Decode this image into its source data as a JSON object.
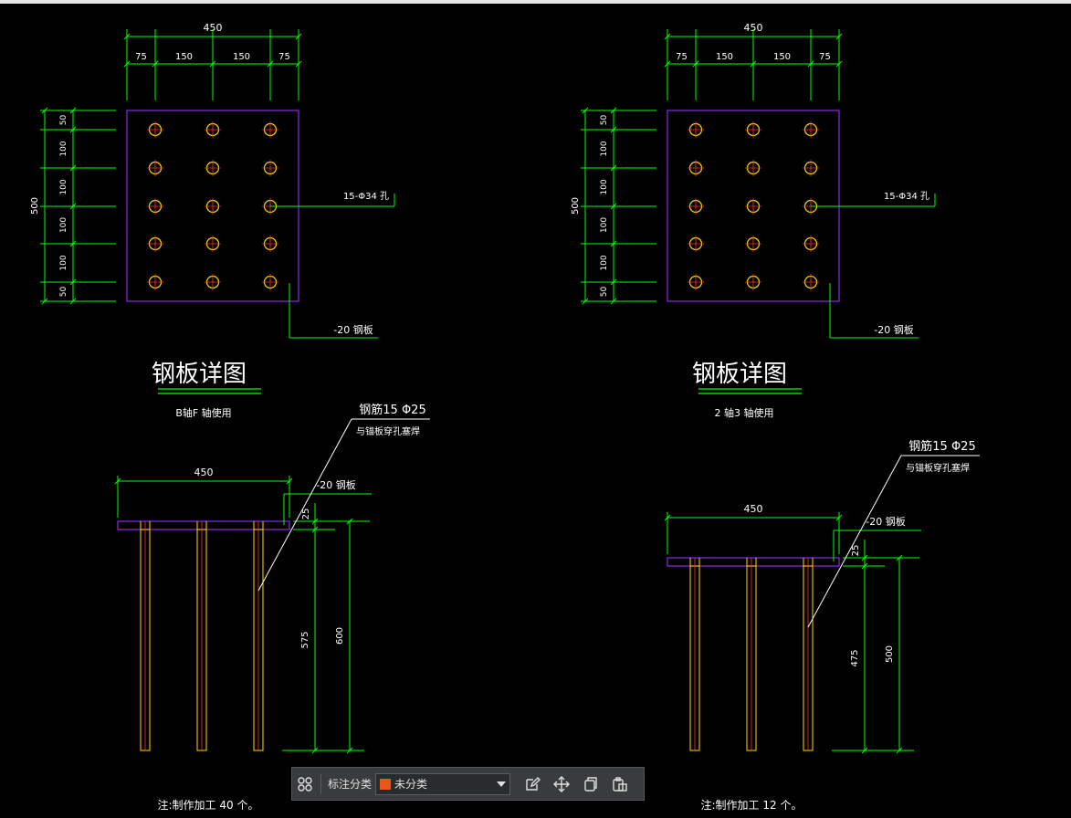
{
  "drawings": [
    {
      "id": "left",
      "plate": {
        "width_dim": "450",
        "col_dims": [
          "75",
          "150",
          "150",
          "75"
        ],
        "height_dim": "500",
        "row_dims": [
          "50",
          "100",
          "100",
          "100",
          "100",
          "50"
        ],
        "hole_note": "15-Φ34  孔",
        "plate_note": "-20  钢板"
      },
      "title": "钢板详图",
      "subtitle": "B轴F 轴使用",
      "elevation": {
        "rebar_note_1": "钢筋15 Φ25",
        "rebar_note_2": "与锚板穿孔塞焊",
        "width_dim": "450",
        "plate_note": "-20  钢板",
        "thk_dim": "25",
        "embed_dim": "575",
        "total_dim": "600"
      },
      "footnote": "注:制作加工   40 个。"
    },
    {
      "id": "right",
      "plate": {
        "width_dim": "450",
        "col_dims": [
          "75",
          "150",
          "150",
          "75"
        ],
        "height_dim": "500",
        "row_dims": [
          "50",
          "100",
          "100",
          "100",
          "100",
          "50"
        ],
        "hole_note": "15-Φ34   孔",
        "plate_note": "-20  钢板"
      },
      "title": "钢板详图",
      "subtitle": "2 轴3 轴使用",
      "elevation": {
        "rebar_note_1": "钢筋15 Φ25",
        "rebar_note_2": "与锚板穿孔塞焊",
        "width_dim": "450",
        "plate_note": "-20  钢板",
        "thk_dim": "25",
        "embed_dim": "475",
        "total_dim": "500"
      },
      "footnote": "注:制作加工   12 个。"
    }
  ],
  "toolbar": {
    "label": "标注分类",
    "selected": "未分类",
    "swatch_color": "#e8561a",
    "icons": [
      "grid-icon",
      "edit-icon",
      "move-icon",
      "copy-icon",
      "paste-icon"
    ]
  },
  "colors": {
    "background": "#000000",
    "dimension": "#00ff00",
    "plate": "#8a2be2",
    "hole": "#ffd700",
    "text": "#ffffff",
    "rebar_outer": "#ffd700",
    "rebar_inner": "#ff3030"
  }
}
